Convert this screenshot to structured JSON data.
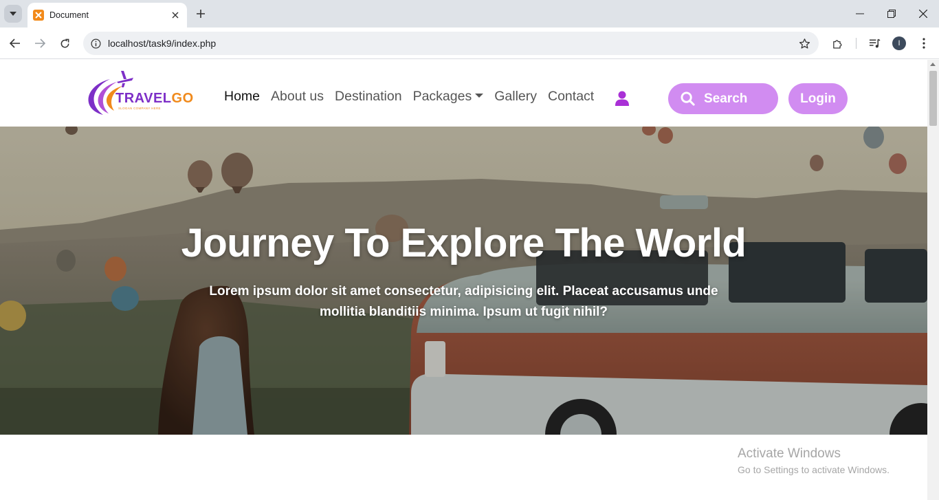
{
  "browser": {
    "tab_title": "Document",
    "url": "localhost/task9/index.php",
    "profile_initial": "I"
  },
  "icons": {
    "tab_search": "chevron-down-icon",
    "favicon": "xampp-icon",
    "close": "close-icon",
    "new_tab": "plus-icon",
    "back": "arrow-left-icon",
    "forward": "arrow-right-icon",
    "reload": "reload-icon",
    "site_info": "info-icon",
    "bookmark": "star-icon",
    "extensions": "puzzle-icon",
    "media": "media-control-icon",
    "menu": "more-vert-icon",
    "search": "search-icon",
    "user": "user-icon"
  },
  "site": {
    "logo_travel": "TRAVEL",
    "logo_go": "GO",
    "logo_tagline": "SLOGAN COMPANY HERE",
    "menu": [
      {
        "label": "Home"
      },
      {
        "label": "About us"
      },
      {
        "label": "Destination"
      },
      {
        "label": "Packages"
      },
      {
        "label": "Gallery"
      },
      {
        "label": "Contact"
      }
    ],
    "search_label": "Search",
    "login_label": "Login",
    "accent_color": "#d18cf1"
  },
  "hero": {
    "title": "Journey To Explore The World",
    "subtitle": "Lorem ipsum dolor sit amet consectetur, adipisicing elit. Placeat accusamus unde mollitia blanditiis minima. Ipsum ut fugit nihil?"
  },
  "watermark": {
    "title": "Activate Windows",
    "subtitle": "Go to Settings to activate Windows."
  }
}
